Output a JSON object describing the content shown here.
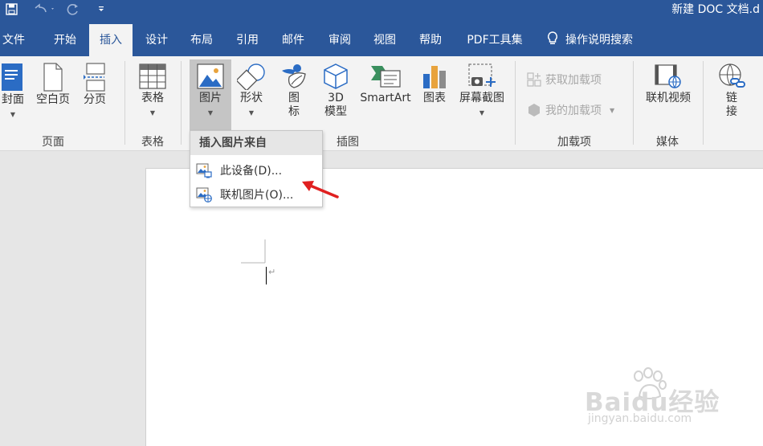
{
  "title_bar": {
    "doc_title": "新建 DOC 文档.d",
    "save_icon": "save-icon",
    "undo_icon": "undo-icon",
    "redo_icon": "redo-icon",
    "customize_icon": "customize-quick-access-icon"
  },
  "tabs": [
    {
      "label": "文件"
    },
    {
      "label": "开始"
    },
    {
      "label": "插入",
      "active": true
    },
    {
      "label": "设计"
    },
    {
      "label": "布局"
    },
    {
      "label": "引用"
    },
    {
      "label": "邮件"
    },
    {
      "label": "审阅"
    },
    {
      "label": "视图"
    },
    {
      "label": "帮助"
    },
    {
      "label": "PDF工具集"
    },
    {
      "label": "操作说明搜索"
    }
  ],
  "ribbon": {
    "pages": {
      "cover": "封面",
      "blank": "空白页",
      "break": "分页",
      "group": "页面"
    },
    "table": {
      "label": "表格",
      "group": "表格"
    },
    "illustrations": {
      "picture": "图片",
      "shapes": "形状",
      "icons_line1": "图",
      "icons_line2": "标",
      "model_line1": "3D",
      "model_line2": "模型",
      "smartart": "SmartArt",
      "chart": "图表",
      "screenshot": "屏幕截图",
      "group": "插图"
    },
    "addins": {
      "get": "获取加载项",
      "my": "我的加载项",
      "group": "加载项"
    },
    "media": {
      "video": "联机视频",
      "group": "媒体"
    },
    "links": {
      "line1": "链",
      "line2": "接"
    }
  },
  "dropdown": {
    "header": "插入图片来自",
    "items": [
      {
        "label": "此设备(D)..."
      },
      {
        "label": "联机图片(O)..."
      }
    ]
  },
  "colors": {
    "accent": "#2b579a",
    "ribbon_bg": "#f3f3f3",
    "arrow": "#e02020"
  },
  "watermark": {
    "brand": "Baidu经验",
    "url": "jingyan.baidu.com"
  }
}
